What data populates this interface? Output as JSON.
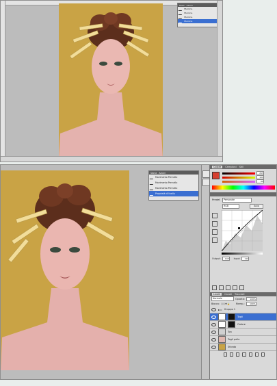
{
  "top_screenshot": {
    "history": {
      "tab_labels": [
        "Histo",
        "Azioni"
      ],
      "items": [
        "Sfumino",
        "Sfumino",
        "Sfumino",
        "Sfumino"
      ],
      "selected_index": 3
    }
  },
  "bottom_screenshot": {
    "history": {
      "tab_labels": [
        "Storia",
        "Azioni"
      ],
      "items": [
        "Movimento Pennello",
        "Movimento Pennello",
        "Movimento Pennello",
        "Proprietà di livello"
      ],
      "selected_index": 3
    },
    "color_panel": {
      "tabs": [
        "Colore",
        "Campioni",
        "Stili"
      ],
      "values": [
        "255",
        "100",
        "68"
      ]
    },
    "adjustments": {
      "preset_label": "Predef.",
      "preset_value": "Personale",
      "channel_value": "RGB",
      "auto_label": "Auto",
      "output_label": "Output:",
      "output_value": "148",
      "input_label": "Input:",
      "input_value": "110"
    },
    "layers": {
      "tabs": [
        "Livelli",
        "Canali",
        "Tracciati"
      ],
      "blend_mode": "Normale",
      "opacity_label": "Opacità:",
      "opacity_value": "100%",
      "lock_label": "Blocca:",
      "fill_label": "Riemp.:",
      "fill_value": "100%",
      "items": [
        {
          "name": "Gruppo 1",
          "type": "group"
        },
        {
          "name": "Tagli",
          "type": "layer",
          "selected": true
        },
        {
          "name": "Ombre",
          "type": "layer"
        },
        {
          "name": "Ton",
          "type": "layer"
        },
        {
          "name": "Tagli pelle",
          "type": "layer"
        },
        {
          "name": "Sfondo",
          "type": "layer"
        }
      ]
    }
  },
  "colors": {
    "background_yellow": "#c9a345",
    "ui_gray": "#bcbcbc",
    "selection_blue": "#3b6fd1"
  }
}
